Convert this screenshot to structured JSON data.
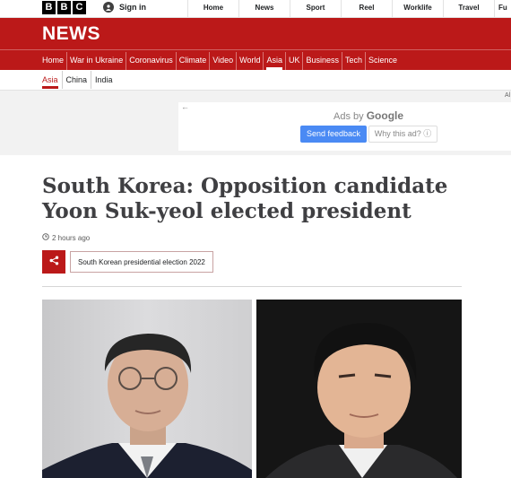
{
  "topbar": {
    "logo_letters": [
      "B",
      "B",
      "C"
    ],
    "signin_label": "Sign in",
    "nav": [
      "Home",
      "News",
      "Sport",
      "Reel",
      "Worklife",
      "Travel",
      "Fu"
    ]
  },
  "news": {
    "title": "NEWS",
    "nav": [
      "Home",
      "War in Ukraine",
      "Coronavirus",
      "Climate",
      "Video",
      "World",
      "Asia",
      "UK",
      "Business",
      "Tech",
      "Science"
    ],
    "active": "Asia"
  },
  "subnav": {
    "items": [
      "Asia",
      "China",
      "India"
    ]
  },
  "ad": {
    "corner_label": "Al",
    "ads_by": "Ads by",
    "google": "Google",
    "send_feedback": "Send feedback",
    "why_this_ad": "Why this ad? ⓘ"
  },
  "article": {
    "headline": "South Korea: Opposition candidate Yoon Suk-yeol elected president",
    "timestamp": "2 hours ago",
    "tag": "South Korean presidential election 2022"
  },
  "colors": {
    "brand_red": "#bb1919",
    "google_blue": "#4a8af4"
  }
}
